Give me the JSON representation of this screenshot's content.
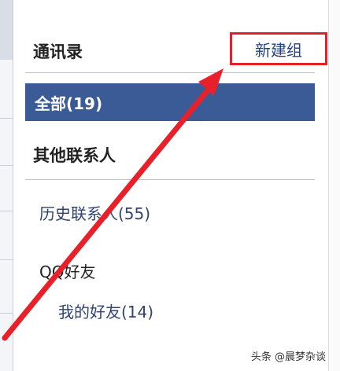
{
  "contacts_header": {
    "title": "通讯录",
    "new_group_label": "新建组"
  },
  "all_contacts": {
    "label": "全部(19)"
  },
  "other_contacts": {
    "title": "其他联系人"
  },
  "history_contacts": {
    "label": "历史联系人(55)"
  },
  "qq_friends": {
    "group_label": "QQ好友",
    "subgroups": [
      {
        "label": "我的好友(14)"
      }
    ]
  },
  "watermark": {
    "text": "头条 @晨梦杂谈"
  },
  "colors": {
    "accent": "#3a5b96",
    "highlight_box": "#e3202a",
    "arrow": "#e8202a",
    "link": "#2f4470"
  },
  "icons": {
    "annotation_arrow": "red-arrow-annotation"
  }
}
